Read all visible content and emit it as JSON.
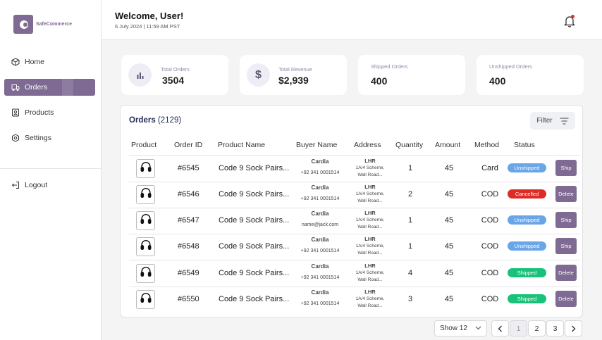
{
  "brand": {
    "name": "SafeCommerce"
  },
  "sidebar": {
    "items": [
      {
        "label": "Home",
        "icon": "cube-icon"
      },
      {
        "label": "Orders",
        "icon": "truck-icon"
      },
      {
        "label": "Products",
        "icon": "user-badge-icon"
      },
      {
        "label": "Settings",
        "icon": "gear-icon"
      }
    ],
    "logout": "Logout"
  },
  "header": {
    "welcome": "Welcome, User!",
    "datetime": "6 July  2024 | 11:59 AM PST"
  },
  "stats": [
    {
      "label": "Total Orders",
      "value": "3504",
      "icon": "bar-chart-icon"
    },
    {
      "label": "Total Revenue",
      "value": "$2,939",
      "icon": "dollar-icon"
    },
    {
      "label": "Shipped Orders",
      "value": "400"
    },
    {
      "label": "Unshipped Orders",
      "value": "400"
    }
  ],
  "orders": {
    "title": "Orders",
    "count": "(2129)",
    "filter_label": "Filter",
    "columns": [
      "Product",
      "Order ID",
      "Product Name",
      "Buyer Name",
      "Address",
      "Quantity",
      "Amount",
      "Method",
      "Status"
    ],
    "rows": [
      {
        "product_icon": "headphones-icon",
        "order_id": "#6545",
        "product_name": "Code 9 Sock Pairs...",
        "buyer": "Cardia",
        "contact": "+92 341 0001514",
        "city": "LHR",
        "addr1": "1A/4 Scheme,",
        "addr2": "Wall Road...",
        "qty": "1",
        "amount": "45",
        "method": "Card",
        "status": "Unshipped",
        "action": "Ship"
      },
      {
        "product_icon": "headphones-icon",
        "order_id": "#6546",
        "product_name": "Code 9 Sock Pairs...",
        "buyer": "Cardia",
        "contact": "+92 341 0001514",
        "city": "LHR",
        "addr1": "1A/4 Scheme,",
        "addr2": "Wall Road...",
        "qty": "2",
        "amount": "45",
        "method": "COD",
        "status": "Cancelled",
        "action": "Delete"
      },
      {
        "product_icon": "headphones-icon",
        "order_id": "#6547",
        "product_name": "Code 9 Sock Pairs...",
        "buyer": "Cardia",
        "contact": "name@jack.com",
        "city": "LHR",
        "addr1": "1A/4 Scheme,",
        "addr2": "Wall Road...",
        "qty": "1",
        "amount": "45",
        "method": "COD",
        "status": "Unshipped",
        "action": "Ship"
      },
      {
        "product_icon": "headphones-icon",
        "order_id": "#6548",
        "product_name": "Code 9 Sock Pairs...",
        "buyer": "Cardia",
        "contact": "+92 341 0001514",
        "city": "LHR",
        "addr1": "1A/4 Scheme,",
        "addr2": "Wall Road...",
        "qty": "1",
        "amount": "45",
        "method": "COD",
        "status": "Unshipped",
        "action": "Ship"
      },
      {
        "product_icon": "headphones-icon",
        "order_id": "#6549",
        "product_name": "Code 9 Sock Pairs...",
        "buyer": "Cardia",
        "contact": "+92 341 0001514",
        "city": "LHR",
        "addr1": "1A/4 Scheme,",
        "addr2": "Wall Road...",
        "qty": "4",
        "amount": "45",
        "method": "COD",
        "status": "Shipped",
        "action": "Delete"
      },
      {
        "product_icon": "headphones-icon",
        "order_id": "#6550",
        "product_name": "Code 9 Sock Pairs...",
        "buyer": "Cardia",
        "contact": "+92 341 0001514",
        "city": "LHR",
        "addr1": "1A/4 Scheme,",
        "addr2": "Wall Road...",
        "qty": "3",
        "amount": "45",
        "method": "COD",
        "status": "Shipped",
        "action": "Delete"
      }
    ]
  },
  "status_colors": {
    "Unshipped": "#6aa5e8",
    "Cancelled": "#dd2b26",
    "Shipped": "#19c27a"
  },
  "accent": "#7e6a92",
  "pagination": {
    "show_label": "Show 12",
    "pages": [
      "1",
      "2",
      "3"
    ],
    "current": "1"
  }
}
